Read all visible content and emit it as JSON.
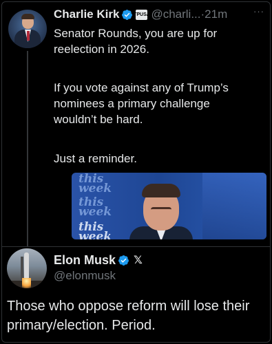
{
  "tweet1": {
    "name": "Charlie Kirk",
    "affiliate_badge": "TPUSA",
    "handle": "@charli...",
    "separator": "·",
    "time": "21m",
    "more": "···",
    "lines": {
      "p1_l1": "Senator Rounds, you are up for",
      "p1_l2": "reelection in 2026.",
      "p2_l1": "If you vote against any of Trump’s",
      "p2_l2": "nominees a primary challenge",
      "p2_l3": "wouldn’t be hard.",
      "p3_l1": "Just a reminder."
    },
    "media": {
      "logo_1": "this",
      "logo_1b": "week",
      "logo_2": "this",
      "logo_2b": "week",
      "logo_3": "this",
      "logo_3b": "week"
    }
  },
  "tweet2": {
    "name": "Elon Musk",
    "x_logo": "𝕏",
    "handle": "@elonmusk",
    "lines": {
      "l1": "Those who oppose reform will lose their",
      "l2": "primary/election. Period."
    }
  },
  "colors": {
    "background": "#000000",
    "text": "#e7e9ea",
    "muted": "#71767b",
    "verified": "#1d9bf0"
  },
  "icons": {
    "verified": "verified-badge-icon",
    "more": "more-options-icon",
    "x": "x-logo-icon"
  }
}
